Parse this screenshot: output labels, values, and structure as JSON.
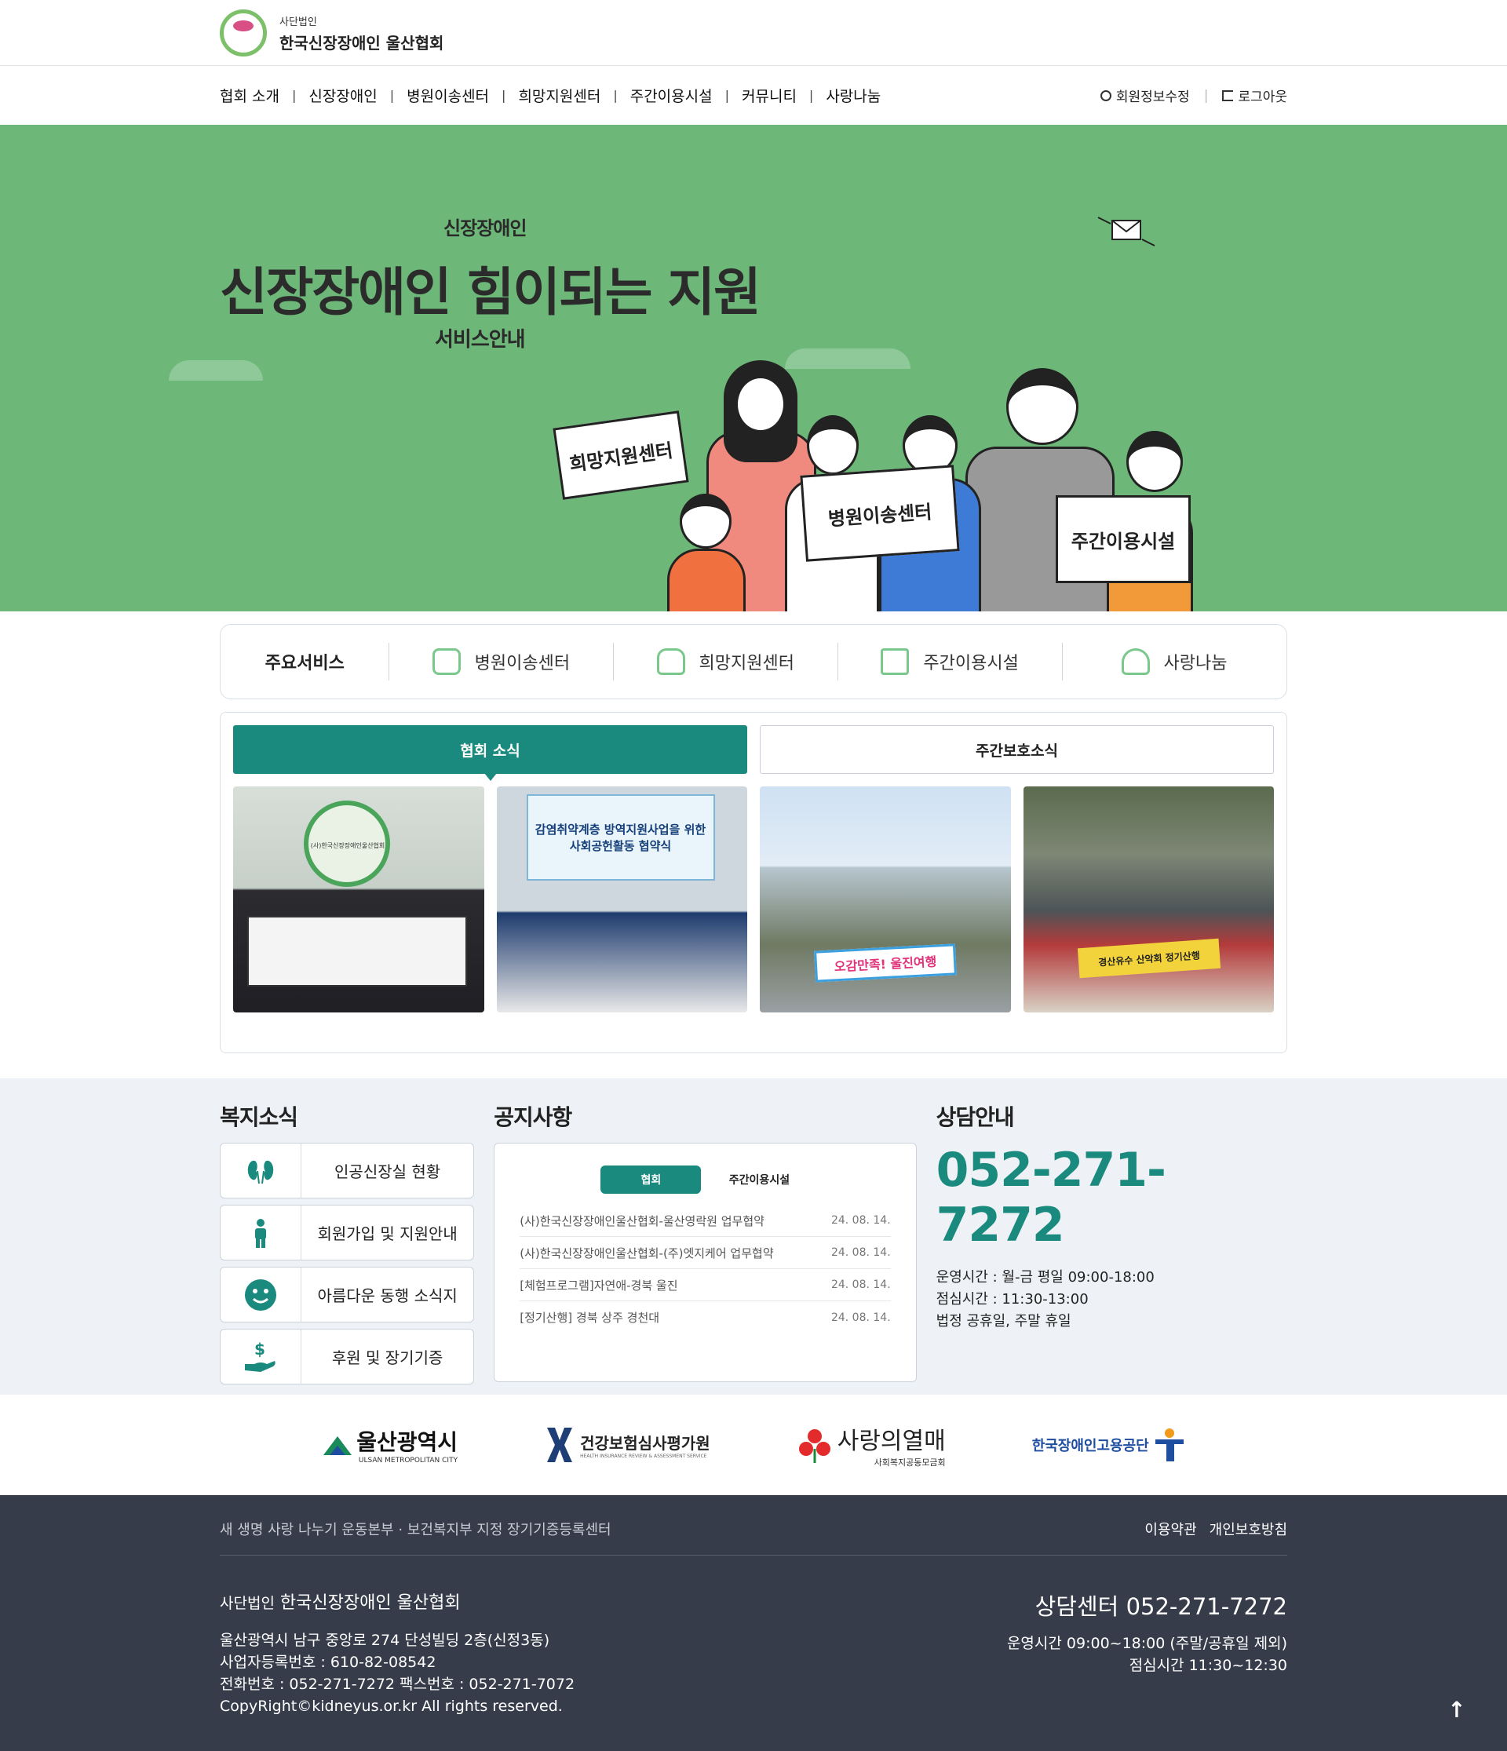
{
  "header": {
    "logo_sub": "사단법인",
    "logo_main": "한국신장장애인 울산협회",
    "nav": [
      "협회 소개",
      "신장장애인",
      "병원이송센터",
      "희망지원센터",
      "주간이용시설",
      "커뮤니티",
      "사랑나눔"
    ],
    "nav_sep": "|",
    "util_profile": "회원정보수정",
    "util_logout": "로그아웃"
  },
  "hero": {
    "top_small": "신장장애인",
    "title": "신장장애인 힘이되는 지원",
    "bottom_small": "서비스안내",
    "signs": [
      "희망지원센터",
      "병원이송센터",
      "주간이용시설"
    ]
  },
  "services": {
    "heading": "주요서비스",
    "items": [
      {
        "label": "병원이송센터",
        "icon": "ambulance-icon"
      },
      {
        "label": "희망지원센터",
        "icon": "heart-house-icon"
      },
      {
        "label": "주간이용시설",
        "icon": "calendar-heart-icon"
      },
      {
        "label": "사랑나눔",
        "icon": "hand-heart-icon"
      }
    ]
  },
  "news": {
    "tabs": [
      "협회 소식",
      "주간보호소식"
    ],
    "photo_captions": [
      "(사)한국신장장애인울산협회",
      "감염취약계층 방역지원사업을 위한 사회공헌활동 협약식",
      "오감만족! 울진여행",
      "경산유수 산악회 정기산행"
    ]
  },
  "welfare": {
    "title": "복지소식",
    "items": [
      {
        "label": "인공신장실 현황",
        "icon": "kidney-icon"
      },
      {
        "label": "회원가입 및 지원안내",
        "icon": "person-icon"
      },
      {
        "label": "아름다운 동행 소식지",
        "icon": "smile-icon"
      },
      {
        "label": "후원 및 장기기증",
        "icon": "donation-icon"
      }
    ]
  },
  "notice": {
    "title": "공지사항",
    "tabs": [
      "협회",
      "주간이용시설"
    ],
    "rows": [
      {
        "title": "(사)한국신장장애인울산협회-울산영락원 업무협약",
        "date": "24. 08. 14."
      },
      {
        "title": "(사)한국신장장애인울산협회-(주)엣지케어 업무협약",
        "date": "24. 08. 14."
      },
      {
        "title": "[체험프로그램]자연애-경북 울진",
        "date": "24. 08. 14."
      },
      {
        "title": "[정기산행] 경북 상주 경천대",
        "date": "24. 08. 14."
      }
    ]
  },
  "consult": {
    "title": "상담안내",
    "phone": "052-271-7272",
    "lines": [
      "운영시간 : 월-금 평일 09:00-18:00",
      "점심시간 : 11:30-13:00",
      "법정 공휴일, 주말 휴일"
    ]
  },
  "partners": {
    "ulsan": "울산광역시",
    "ulsan_en": "ULSAN METROPOLITAN CITY",
    "hira": "건강보험심사평가원",
    "hira_en": "HEALTH INSURANCE REVIEW & ASSESSMENT SERVICE",
    "chest": "사랑의열매",
    "chest_sub": "사회복지공동모금회",
    "kead": "한국장애인고용공단"
  },
  "footer": {
    "tagline": "새 생명 사랑 나누기 운동본부 · 보건복지부 지정 장기기증등록센터",
    "links": [
      "이용약관",
      "개인보호방침"
    ],
    "org_prefix": "사단법인",
    "org_name": "한국신장장애인 울산협회",
    "lines": [
      "울산광역시 남구 중앙로 274 단성빌딩 2층(신정3동)",
      "사업자등록번호 : 610-82-08542",
      "전화번호 : 052-271-7272 팩스번호 : 052-271-7072",
      "CopyRight©kidneyus.or.kr All rights reserved."
    ],
    "center_phone": "상담센터 052-271-7272",
    "hours": [
      "운영시간 09:00~18:00 (주말/공휴일 제외)",
      "점심시간 11:30~12:30"
    ],
    "top_button": "↑"
  },
  "colors": {
    "green": "#6db779",
    "teal": "#1a8a7e",
    "footer": "#373c4a"
  }
}
